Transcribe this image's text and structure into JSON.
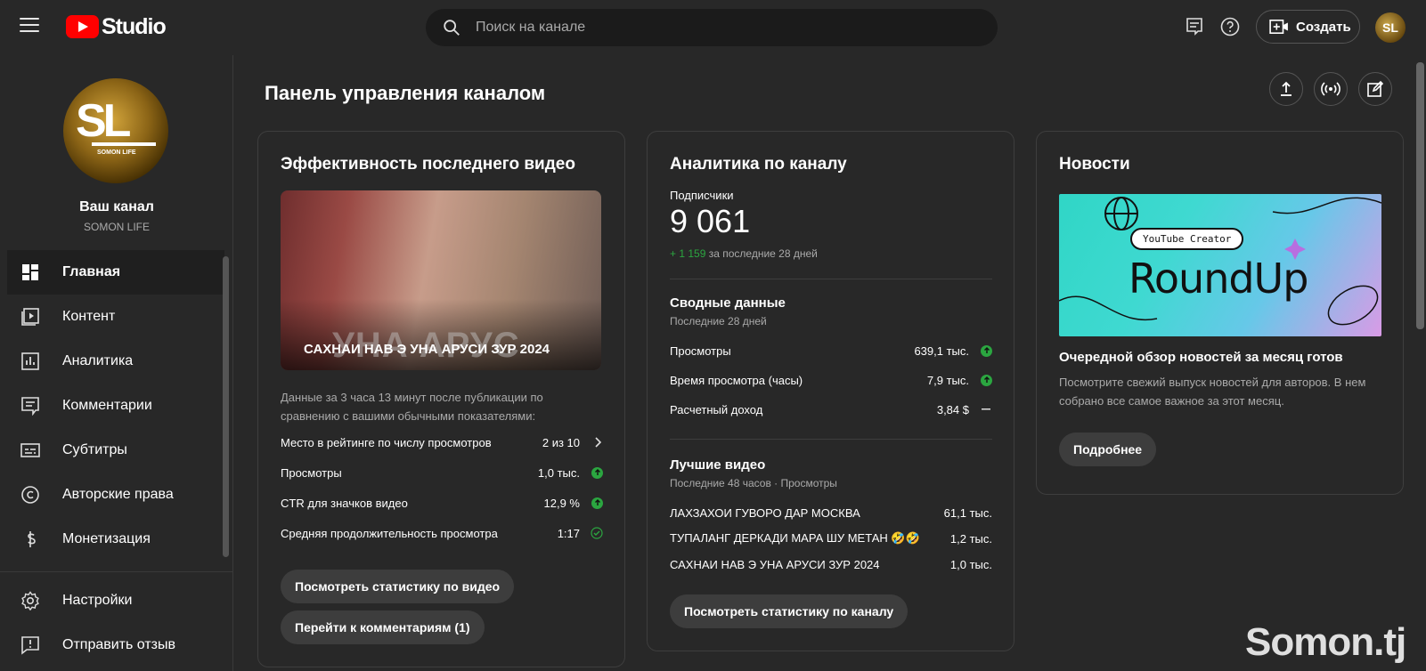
{
  "header": {
    "logo_text": "Studio",
    "search_placeholder": "Поиск на канале",
    "create_label": "Создать",
    "avatar_initials": "SL"
  },
  "sidebar": {
    "channel_title": "Ваш канал",
    "channel_handle": "SOMON LIFE",
    "avatar_text": "SL",
    "avatar_name": "SOMON LIFE",
    "items": [
      {
        "label": "Главная",
        "icon": "dashboard-icon",
        "active": true
      },
      {
        "label": "Контент",
        "icon": "content-icon"
      },
      {
        "label": "Аналитика",
        "icon": "analytics-icon"
      },
      {
        "label": "Комментарии",
        "icon": "comments-icon"
      },
      {
        "label": "Субтитры",
        "icon": "subtitles-icon"
      },
      {
        "label": "Авторские права",
        "icon": "copyright-icon"
      },
      {
        "label": "Монетизация",
        "icon": "monetization-icon"
      }
    ],
    "bottom_items": [
      {
        "label": "Настройки",
        "icon": "gear-icon"
      },
      {
        "label": "Отправить отзыв",
        "icon": "feedback-icon"
      }
    ]
  },
  "main": {
    "page_title": "Панель управления каналом"
  },
  "latest_video": {
    "title": "Эффективность последнего видео",
    "thumbnail_title": "САХНАИ НАВ Э УНА АРУСИ ЗУР 2024",
    "thumbnail_overlay": "УНА АРУС",
    "description": "Данные за 3 часа 13 минут после публикации по сравнению с вашими обычными показателями:",
    "stats": [
      {
        "label": "Место в рейтинге по числу просмотров",
        "value": "2 из 10",
        "indicator": "chevron"
      },
      {
        "label": "Просмотры",
        "value": "1,0 тыс.",
        "indicator": "up"
      },
      {
        "label": "CTR для значков видео",
        "value": "12,9 %",
        "indicator": "up"
      },
      {
        "label": "Средняя продолжительность просмотра",
        "value": "1:17",
        "indicator": "check"
      }
    ],
    "btn_stats": "Посмотреть статистику по видео",
    "btn_comments": "Перейти к комментариям (1)"
  },
  "analytics": {
    "title": "Аналитика по каналу",
    "subs_label": "Подписчики",
    "subs_value": "9 061",
    "subs_delta": "+ 1 159",
    "subs_period": "за последние 28 дней",
    "summary_title": "Сводные данные",
    "summary_period": "Последние 28 дней",
    "summary": [
      {
        "label": "Просмотры",
        "value": "639,1 тыс.",
        "indicator": "up"
      },
      {
        "label": "Время просмотра (часы)",
        "value": "7,9 тыс.",
        "indicator": "up"
      },
      {
        "label": "Расчетный доход",
        "value": "3,84 $",
        "indicator": "dash"
      }
    ],
    "top_title": "Лучшие видео",
    "top_period": "Последние 48 часов · Просмотры",
    "top_videos": [
      {
        "title": "ЛАХЗАХОИ ГУВОРО ДАР МОСКВА",
        "views": "61,1 тыс."
      },
      {
        "title": "ТУПАЛАНГ ДЕРКАДИ МАРА ШУ МЕТАН 🤣🤣",
        "views": "1,2 тыс."
      },
      {
        "title": "САХНАИ НАВ Э УНА АРУСИ ЗУР 2024",
        "views": "1,0 тыс."
      }
    ],
    "btn": "Посмотреть статистику по каналу"
  },
  "news": {
    "title": "Новости",
    "image_pill": "YouTube Creator",
    "image_big": "RoundUp",
    "headline": "Очередной обзор новостей за месяц готов",
    "body": "Посмотрите свежий выпуск новостей для авторов. В нем собрано все самое важное за этот месяц.",
    "btn": "Подробнее"
  },
  "watermark": "Somon.tj",
  "colors": {
    "background": "#282828",
    "accent_red": "#ff0000",
    "positive_green": "#2ba640",
    "muted_text": "#aaaaaa"
  }
}
